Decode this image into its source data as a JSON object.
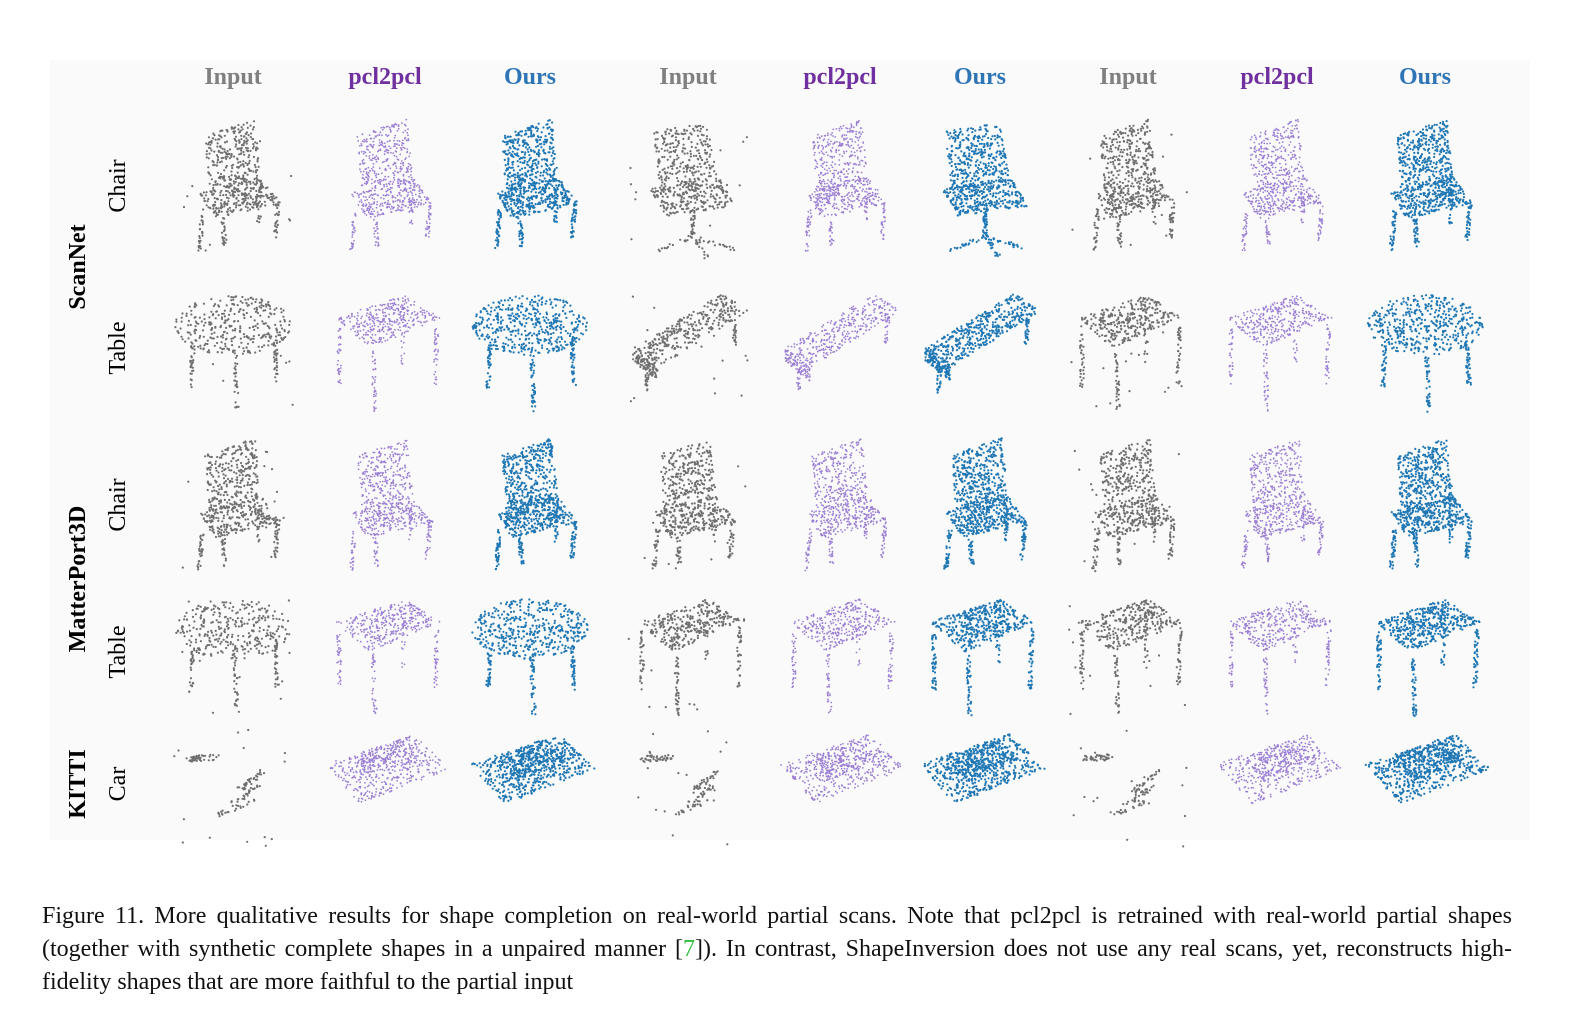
{
  "columns": [
    {
      "label": "Input",
      "color": "#808080"
    },
    {
      "label": "pcl2pcl",
      "color": "#7030a0"
    },
    {
      "label": "Ours",
      "color": "#2e75b6"
    },
    {
      "label": "Input",
      "color": "#808080"
    },
    {
      "label": "pcl2pcl",
      "color": "#7030a0"
    },
    {
      "label": "Ours",
      "color": "#2e75b6"
    },
    {
      "label": "Input",
      "color": "#808080"
    },
    {
      "label": "pcl2pcl",
      "color": "#7030a0"
    },
    {
      "label": "Ours",
      "color": "#2e75b6"
    }
  ],
  "groups": [
    {
      "label": "ScanNet",
      "rows": [
        "Chair",
        "Table"
      ]
    },
    {
      "label": "MatterPort3D",
      "rows": [
        "Chair",
        "Table"
      ]
    },
    {
      "label": "KITTI",
      "rows": [
        "Car"
      ]
    }
  ],
  "point_colors": {
    "input": "#6f6f6f",
    "pcl2pcl": "#9b7fd4",
    "ours": "#1f77b4"
  },
  "caption": {
    "text_before": "Figure 11. More qualitative results for shape completion on real-world partial scans. Note that pcl2pcl is retrained with real-world partial shapes (together with synthetic complete shapes in a unpaired manner [",
    "citation": "7",
    "text_after": "]). In contrast, ShapeInversion does not use any real scans, yet, reconstructs high-fidelity shapes that are more faithful to the partial input"
  }
}
